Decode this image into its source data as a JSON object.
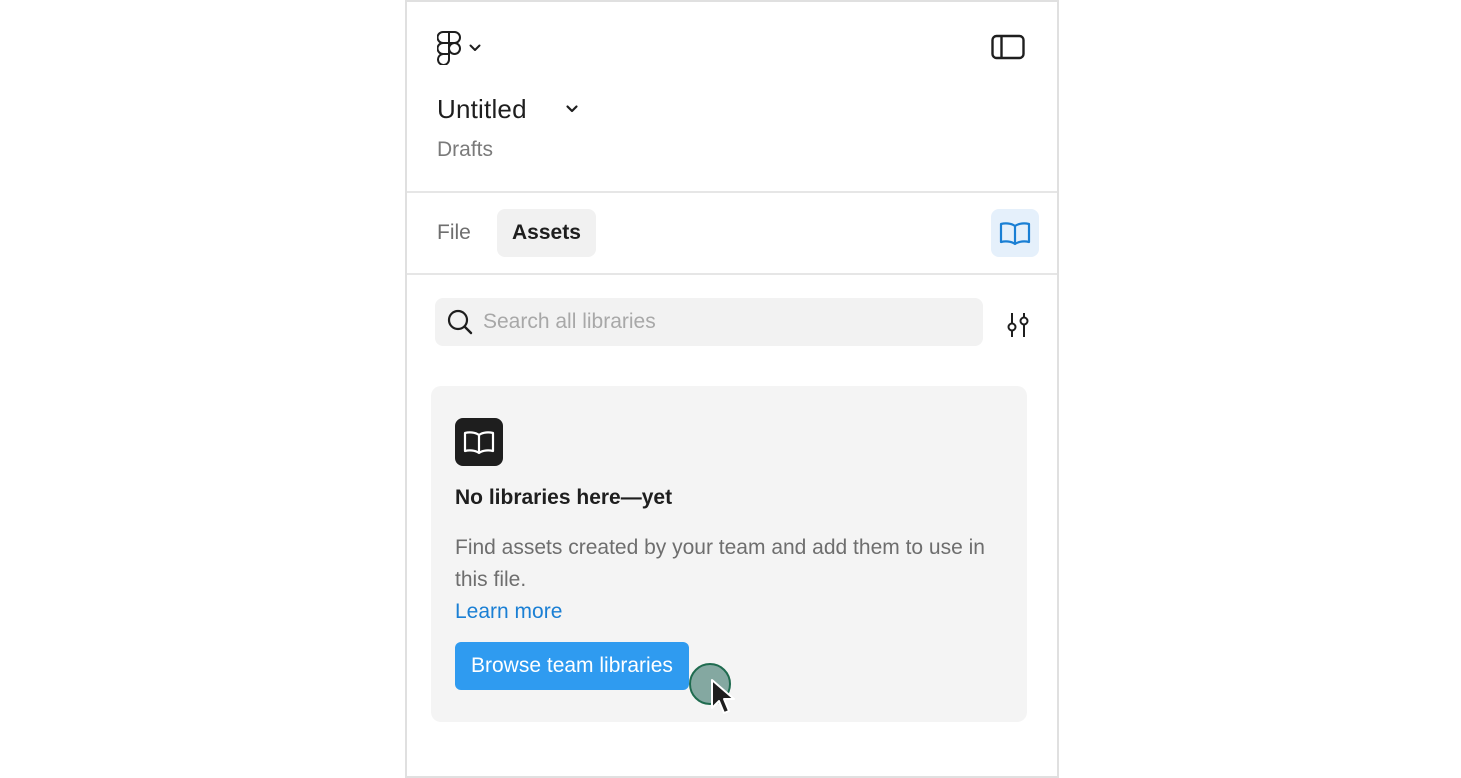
{
  "header": {
    "file_title": "Untitled",
    "file_location": "Drafts"
  },
  "tabs": [
    {
      "label": "File",
      "active": false
    },
    {
      "label": "Assets",
      "active": true
    }
  ],
  "search": {
    "placeholder": "Search all libraries",
    "value": ""
  },
  "empty_state": {
    "heading": "No libraries here—yet",
    "body": "Find assets created by your team and add them to use in this file.",
    "link_label": "Learn more",
    "button_label": "Browse team libraries"
  },
  "icons": {
    "logo": "figma-logo-icon",
    "sidebar_toggle": "sidebar-toggle-icon",
    "library": "book-icon",
    "search": "search-icon",
    "filter": "sliders-icon",
    "cursor": "mouse-pointer-icon"
  },
  "colors": {
    "accent": "#2f9bf0",
    "link": "#1a7fd4",
    "library_toggle_bg": "#e5f0fb",
    "card_bg": "#f4f4f4"
  }
}
